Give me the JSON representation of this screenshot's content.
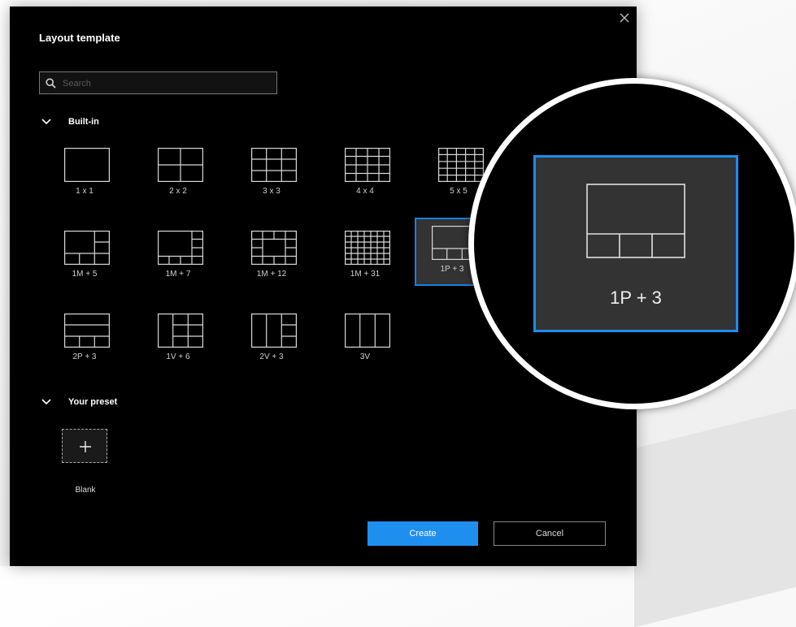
{
  "dialog": {
    "title": "Layout template",
    "search": {
      "placeholder": "Search",
      "value": ""
    },
    "sections": {
      "builtin": {
        "label": "Built-in",
        "expanded": true
      },
      "preset": {
        "label": "Your preset",
        "expanded": true
      }
    },
    "builtin_templates": [
      {
        "id": "1x1",
        "label": "1 x 1"
      },
      {
        "id": "2x2",
        "label": "2 x 2"
      },
      {
        "id": "3x3",
        "label": "3 x 3"
      },
      {
        "id": "4x4",
        "label": "4 x 4"
      },
      {
        "id": "5x5",
        "label": "5 x 5"
      },
      {
        "id": "1m5",
        "label": "1M + 5"
      },
      {
        "id": "1m7",
        "label": "1M + 7"
      },
      {
        "id": "1m12",
        "label": "1M + 12"
      },
      {
        "id": "1m31",
        "label": "1M + 31"
      },
      {
        "id": "1p3",
        "label": "1P + 3",
        "selected": true
      },
      {
        "id": "2p3",
        "label": "2P + 3"
      },
      {
        "id": "1v6",
        "label": "1V + 6"
      },
      {
        "id": "2v3",
        "label": "2V + 3"
      },
      {
        "id": "3v",
        "label": "3V"
      }
    ],
    "preset_items": [
      {
        "label": "Blank",
        "icon": "plus-icon"
      }
    ],
    "buttons": {
      "create": "Create",
      "cancel": "Cancel"
    },
    "zoom_callout": {
      "label": "1P + 3"
    }
  },
  "colors": {
    "dialog_bg": "#000000",
    "accent": "#1f8fef",
    "selected_tile_bg": "#333333",
    "line": "#d8d8d8"
  }
}
